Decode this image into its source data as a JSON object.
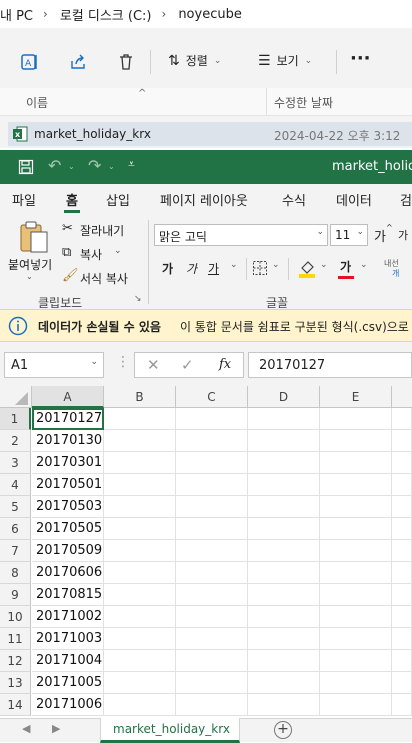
{
  "explorer": {
    "breadcrumb": [
      "내 PC",
      "로컬 디스크 (C:)",
      "noyecube"
    ],
    "commands": {
      "sort": "정렬",
      "view": "보기",
      "more": "···"
    },
    "columns": {
      "name": "이름",
      "modified": "수정한 날짜"
    },
    "file": {
      "name": "market_holiday_krx",
      "modified": "2024-04-22 오후 3:12"
    }
  },
  "excel": {
    "title": "market_holiday",
    "tabs": [
      "파일",
      "홈",
      "삽입",
      "페이지 레이아웃",
      "수식",
      "데이터",
      "검"
    ],
    "active_tab": "홈",
    "clipboard": {
      "paste": "붙여넣기",
      "cut": "잘라내기",
      "copy": "복사",
      "format_painter": "서식 복사",
      "group": "클립보드"
    },
    "font": {
      "name": "맑은 고딕",
      "size": "11",
      "grow": "가",
      "shrink": "가",
      "bold": "가",
      "italic": "가",
      "underline": "가",
      "font_color": "가",
      "phonetic": "내선",
      "group": "글꼴"
    },
    "infobar": {
      "bold": "데이터가 손실될 수 있음",
      "text": "이 통합 문서를 쉼표로 구분된 형식(.csv)으로"
    },
    "namebox": "A1",
    "formula": "20170127",
    "fx": "fx",
    "columns": [
      "A",
      "B",
      "C",
      "D",
      "E"
    ],
    "rows": [
      {
        "n": "1",
        "a": "20170127"
      },
      {
        "n": "2",
        "a": "20170130"
      },
      {
        "n": "3",
        "a": "20170301"
      },
      {
        "n": "4",
        "a": "20170501"
      },
      {
        "n": "5",
        "a": "20170503"
      },
      {
        "n": "6",
        "a": "20170505"
      },
      {
        "n": "7",
        "a": "20170509"
      },
      {
        "n": "8",
        "a": "20170606"
      },
      {
        "n": "9",
        "a": "20170815"
      },
      {
        "n": "10",
        "a": "20171002"
      },
      {
        "n": "11",
        "a": "20171003"
      },
      {
        "n": "12",
        "a": "20171004"
      },
      {
        "n": "13",
        "a": "20171005"
      },
      {
        "n": "14",
        "a": "20171006"
      }
    ],
    "sheet_tab": "market_holiday_krx",
    "add_sheet": "+",
    "colors": {
      "green": "#217346",
      "info_bg": "#fff4ce",
      "accent_blue": "#1a6fc4",
      "red": "#e81123",
      "yellow": "#ffd800"
    }
  }
}
